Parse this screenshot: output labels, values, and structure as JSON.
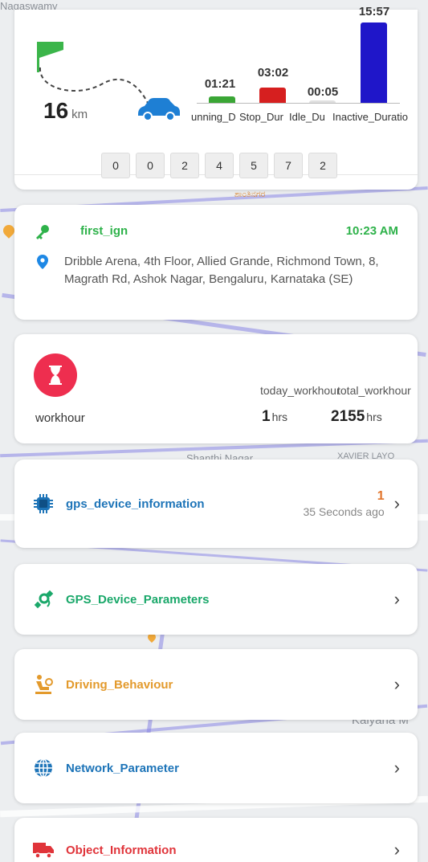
{
  "map": {
    "labels": [
      "Nagaswamy",
      "Shanthi Nagar",
      "Kalyana M",
      "XAVIER LAYO",
      "ಶಾಂತಿನಗರ"
    ]
  },
  "trip": {
    "distance_value": "16",
    "distance_unit": "km",
    "bars": [
      {
        "label": "running_Duration",
        "label_visible": "unning_D",
        "value": "01:21",
        "color": "#3aa635"
      },
      {
        "label": "Stop_Duration",
        "label_visible": "Stop_Dur",
        "value": "03:02",
        "color": "#d61f1f"
      },
      {
        "label": "Idle_Duration",
        "label_visible": "Idle_Du",
        "value": "00:05",
        "color": "#e0e0e0"
      },
      {
        "label": "Inactive_Duration",
        "label_visible": "Inactive_Duratio",
        "value": "15:57",
        "color": "#1f16c9"
      }
    ],
    "odometer_digits": [
      "0",
      "0",
      "2",
      "4",
      "5",
      "7",
      "2"
    ]
  },
  "ignition": {
    "title": "first_ign",
    "time": "10:23 AM",
    "address": "Dribble Arena, 4th Floor, Allied Grande, Richmond Town, 8, Magrath Rd, Ashok Nagar, Bengaluru, Karnataka (SE)",
    "title_color": "#2eb24a"
  },
  "workhour": {
    "label": "workhour",
    "today_title": "today_workhour",
    "total_title": "total_workhour",
    "today_value": "1",
    "total_value": "2155",
    "unit": "hrs"
  },
  "menu": [
    {
      "key": "gps_device_information",
      "label": "gps_device_information",
      "color": "#1d74b8",
      "icon": "chip-icon",
      "count": "1",
      "ago": "35 Seconds ago"
    },
    {
      "key": "gps_device_parameters",
      "label": "GPS_Device_Parameters",
      "color": "#1aa86a",
      "icon": "satellite-icon"
    },
    {
      "key": "driving_behaviour",
      "label": "Driving_Behaviour",
      "color": "#e39a2c",
      "icon": "driver-seat-icon"
    },
    {
      "key": "network_parameter",
      "label": "Network_Parameter",
      "color": "#1d74b8",
      "icon": "globe-icon"
    },
    {
      "key": "object_information",
      "label": "Object_Information",
      "color": "#e0343a",
      "icon": "truck-icon"
    }
  ]
}
